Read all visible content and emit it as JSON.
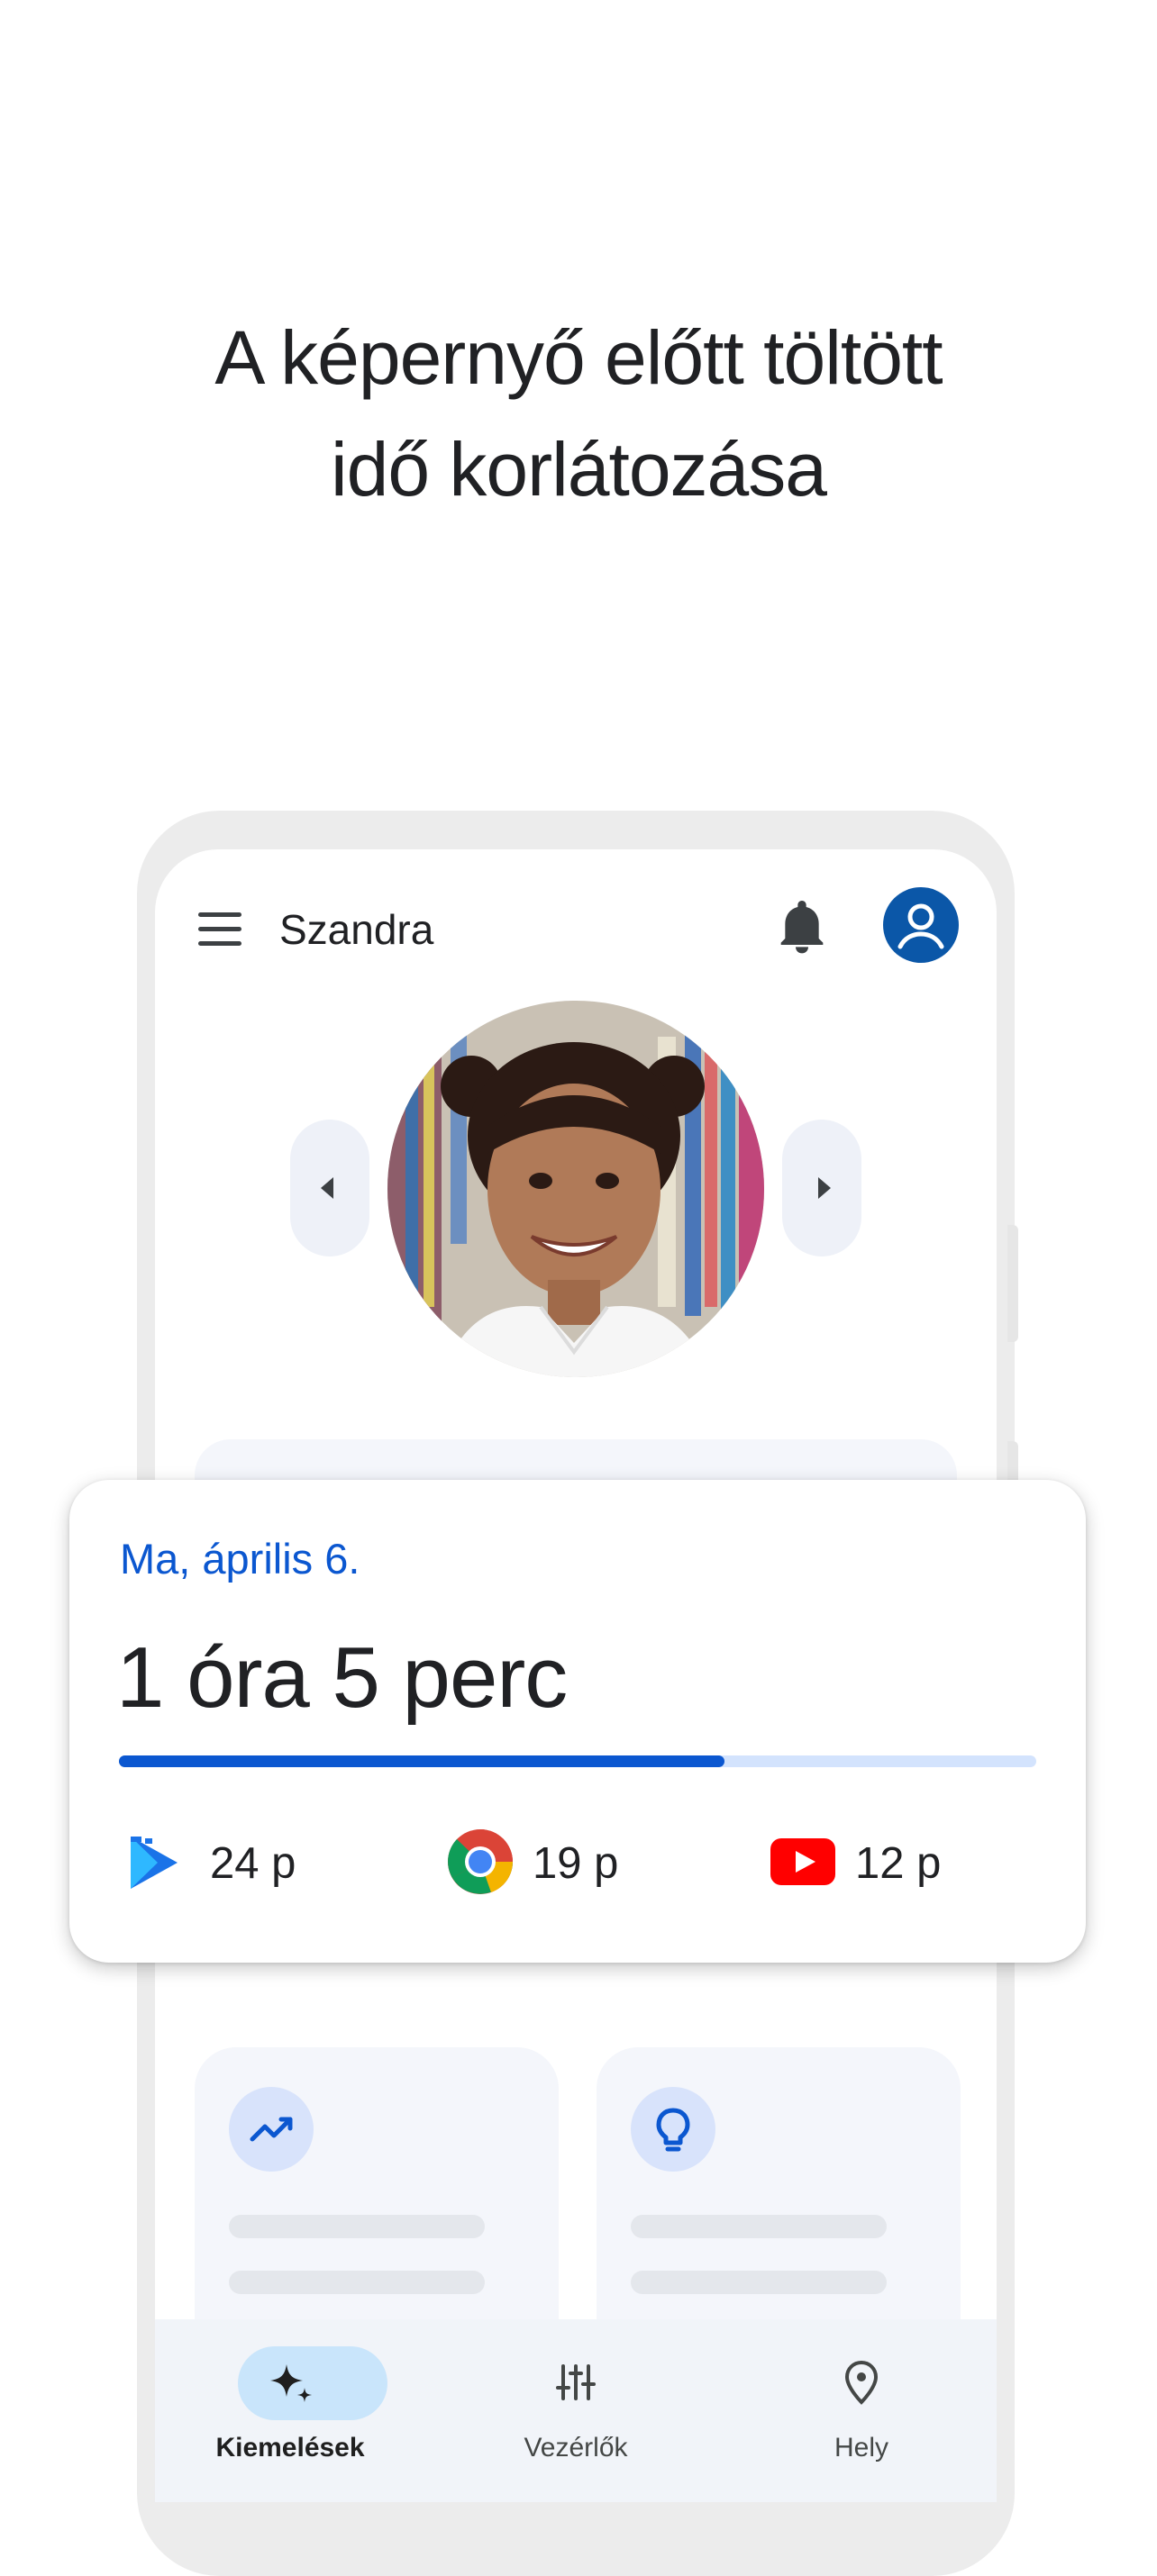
{
  "headline": {
    "line1": "A képernyő előtt töltött",
    "line2": "idő korlátozása"
  },
  "app_bar": {
    "title": "Szandra"
  },
  "summary": {
    "date": "Ma, április 6.",
    "total": "1 óra 5 perc",
    "progress_fraction": 0.66,
    "apps": [
      {
        "icon": "play-store-icon",
        "value": "24 p"
      },
      {
        "icon": "chrome-icon",
        "value": "19 p"
      },
      {
        "icon": "youtube-icon",
        "value": "12 p"
      }
    ]
  },
  "cards": [
    {
      "icon": "trending-up-icon"
    },
    {
      "icon": "lightbulb-icon"
    }
  ],
  "bottom_nav": [
    {
      "label": "Kiemelések",
      "icon": "sparkle-icon",
      "active": true
    },
    {
      "label": "Vezérlők",
      "icon": "sliders-icon",
      "active": false
    },
    {
      "label": "Hely",
      "icon": "location-pin-icon",
      "active": false
    }
  ],
  "colors": {
    "accent": "#0b57d0",
    "account": "#0b57a8",
    "nav_active": "#c9e5fb"
  }
}
